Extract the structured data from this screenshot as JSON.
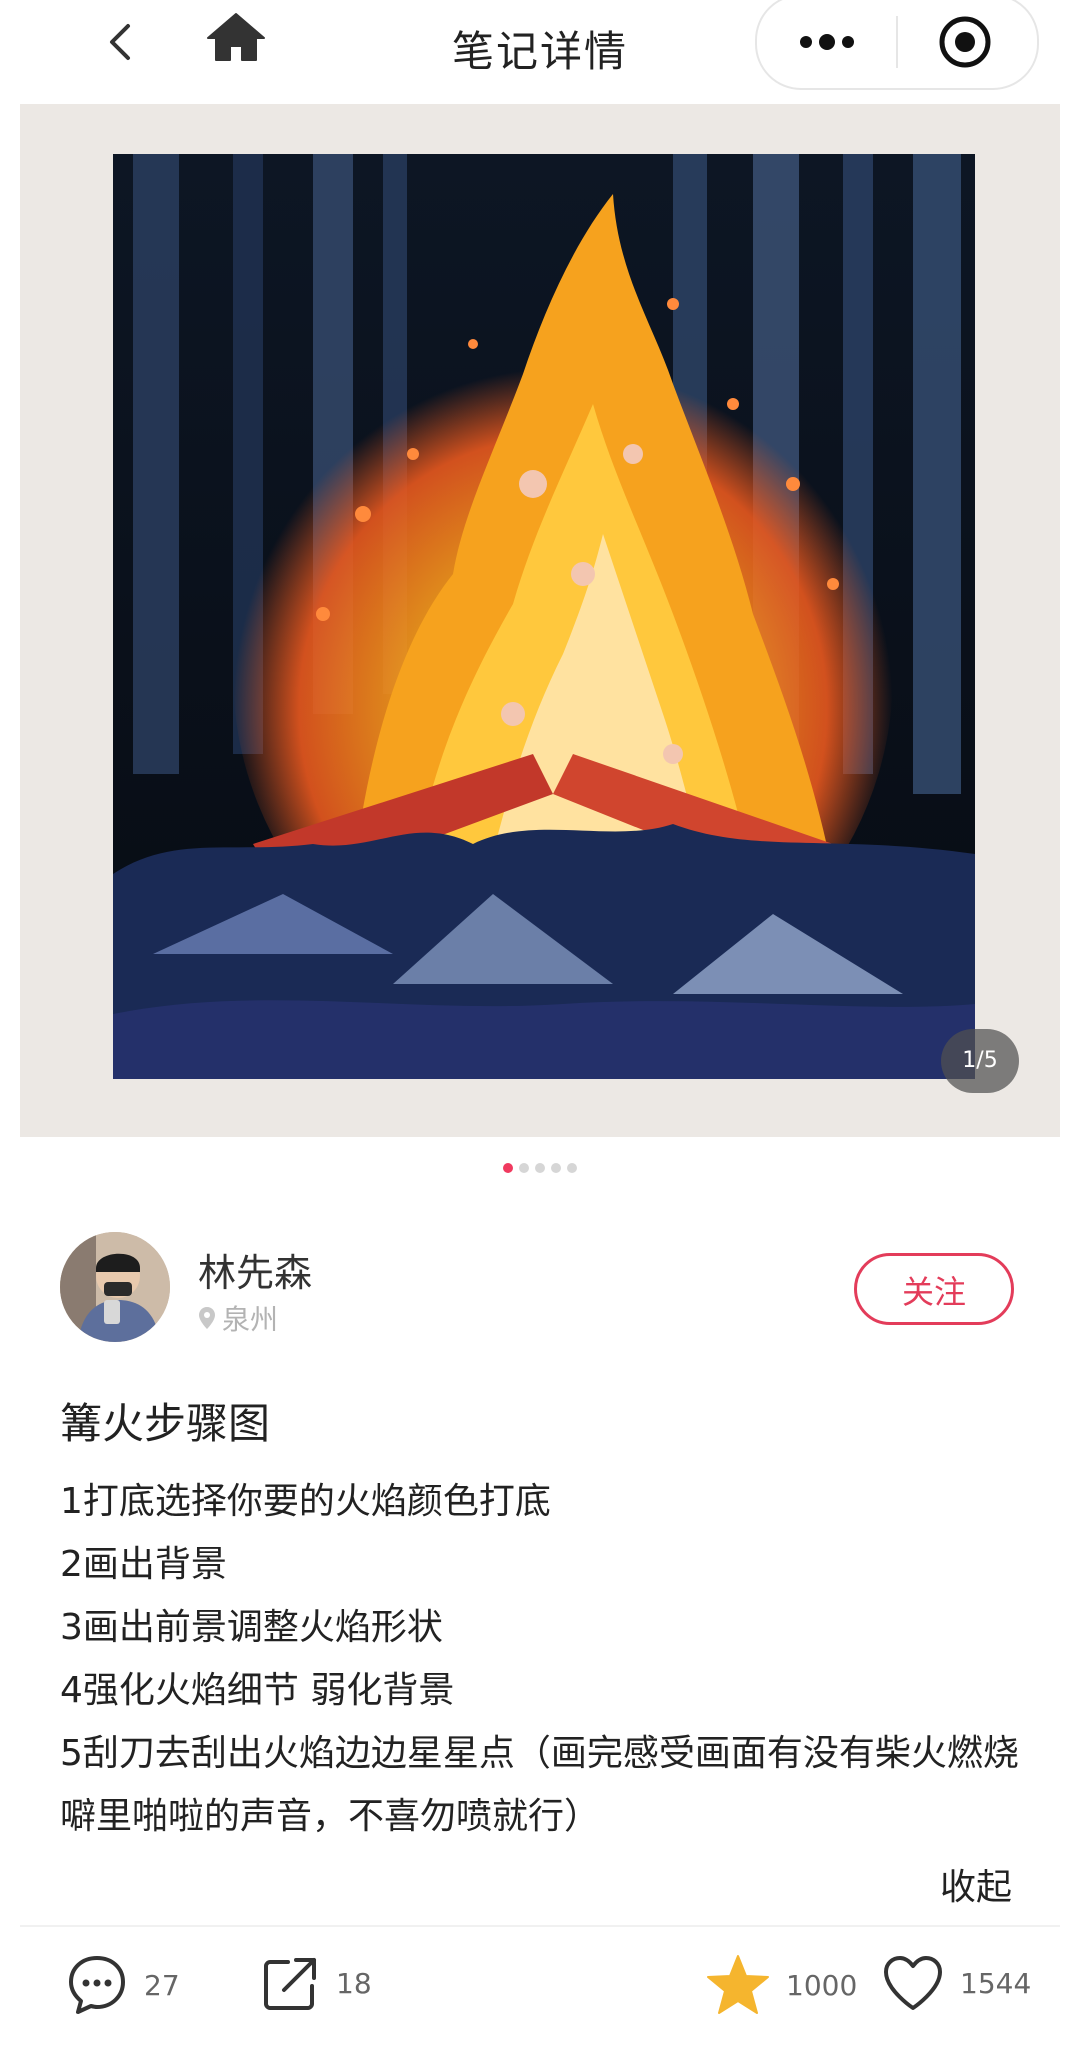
{
  "header": {
    "title": "笔记详情",
    "icons": [
      "back-icon",
      "home-icon",
      "more-icon",
      "target-icon"
    ]
  },
  "carousel": {
    "counter": "1/5",
    "current": 1,
    "total": 5
  },
  "author": {
    "name": "林先森",
    "location": "泉州",
    "follow_label": "关注"
  },
  "note": {
    "title": "篝火步骤图",
    "lines": [
      "1打底选择你要的火焰颜色打底",
      "2画出背景",
      "3画出前景调整火焰形状",
      "4强化火焰细节 弱化背景",
      "5刮刀去刮出火焰边边星星点（画完感受画面有没有柴火燃烧噼里啪啦的声音，不喜勿喷就行）"
    ],
    "collapse_label": "收起"
  },
  "actions": {
    "comments": "27",
    "shares": "18",
    "favorites": "1000",
    "likes": "1544"
  },
  "colors": {
    "accent": "#e33c5a",
    "dot_active": "#f03a5f",
    "star": "#f5b52e"
  }
}
